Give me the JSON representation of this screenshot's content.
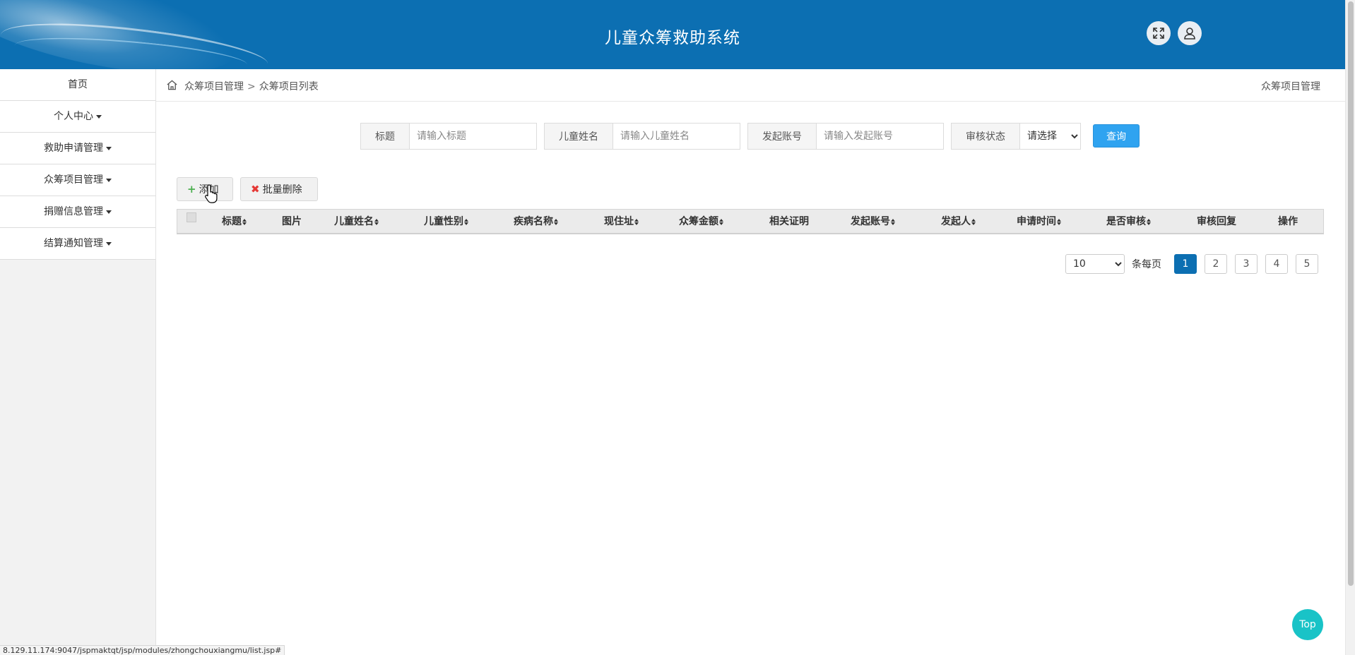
{
  "header": {
    "title": "儿童众筹救助系统",
    "fullscreen_icon": "expand-icon",
    "user_icon": "user-icon"
  },
  "sidebar": {
    "items": [
      {
        "label": "首页",
        "has_caret": false
      },
      {
        "label": "个人中心",
        "has_caret": true
      },
      {
        "label": "救助申请管理",
        "has_caret": true
      },
      {
        "label": "众筹项目管理",
        "has_caret": true
      },
      {
        "label": "捐赠信息管理",
        "has_caret": true
      },
      {
        "label": "结算通知管理",
        "has_caret": true
      }
    ]
  },
  "breadcrumb": {
    "home_icon": "home-icon",
    "level1": "众筹项目管理",
    "separator": ">",
    "level2": "众筹项目列表",
    "right_title": "众筹项目管理"
  },
  "search": {
    "title_label": "标题",
    "title_placeholder": "请输入标题",
    "child_name_label": "儿童姓名",
    "child_name_placeholder": "请输入儿童姓名",
    "account_label": "发起账号",
    "account_placeholder": "请输入发起账号",
    "status_label": "审核状态",
    "status_selected": "请选择",
    "query_button": "查询"
  },
  "actions": {
    "add_label": "添加",
    "batch_delete_label": "批量删除"
  },
  "table": {
    "columns": [
      {
        "label": "标题",
        "sortable": true
      },
      {
        "label": "图片",
        "sortable": false
      },
      {
        "label": "儿童姓名",
        "sortable": true
      },
      {
        "label": "儿童性别",
        "sortable": true
      },
      {
        "label": "疾病名称",
        "sortable": true
      },
      {
        "label": "现住址",
        "sortable": true
      },
      {
        "label": "众筹金额",
        "sortable": true
      },
      {
        "label": "相关证明",
        "sortable": false
      },
      {
        "label": "发起账号",
        "sortable": true
      },
      {
        "label": "发起人",
        "sortable": true
      },
      {
        "label": "申请时间",
        "sortable": true
      },
      {
        "label": "是否审核",
        "sortable": true
      },
      {
        "label": "审核回复",
        "sortable": false
      },
      {
        "label": "操作",
        "sortable": false
      }
    ],
    "rows": []
  },
  "pagination": {
    "page_size": "10",
    "page_size_label": "条每页",
    "pages": [
      "1",
      "2",
      "3",
      "4",
      "5"
    ],
    "current_page": "1"
  },
  "top_button": "Top",
  "status_bar": "8.129.11.174:9047/jspmaktqt/jsp/modules/zhongchouxiangmu/list.jsp#",
  "colors": {
    "header_bg": "#0c6fb2",
    "query_button": "#2fa3f0",
    "active_page": "#0c6fb2",
    "top_button": "#19c3c7"
  }
}
